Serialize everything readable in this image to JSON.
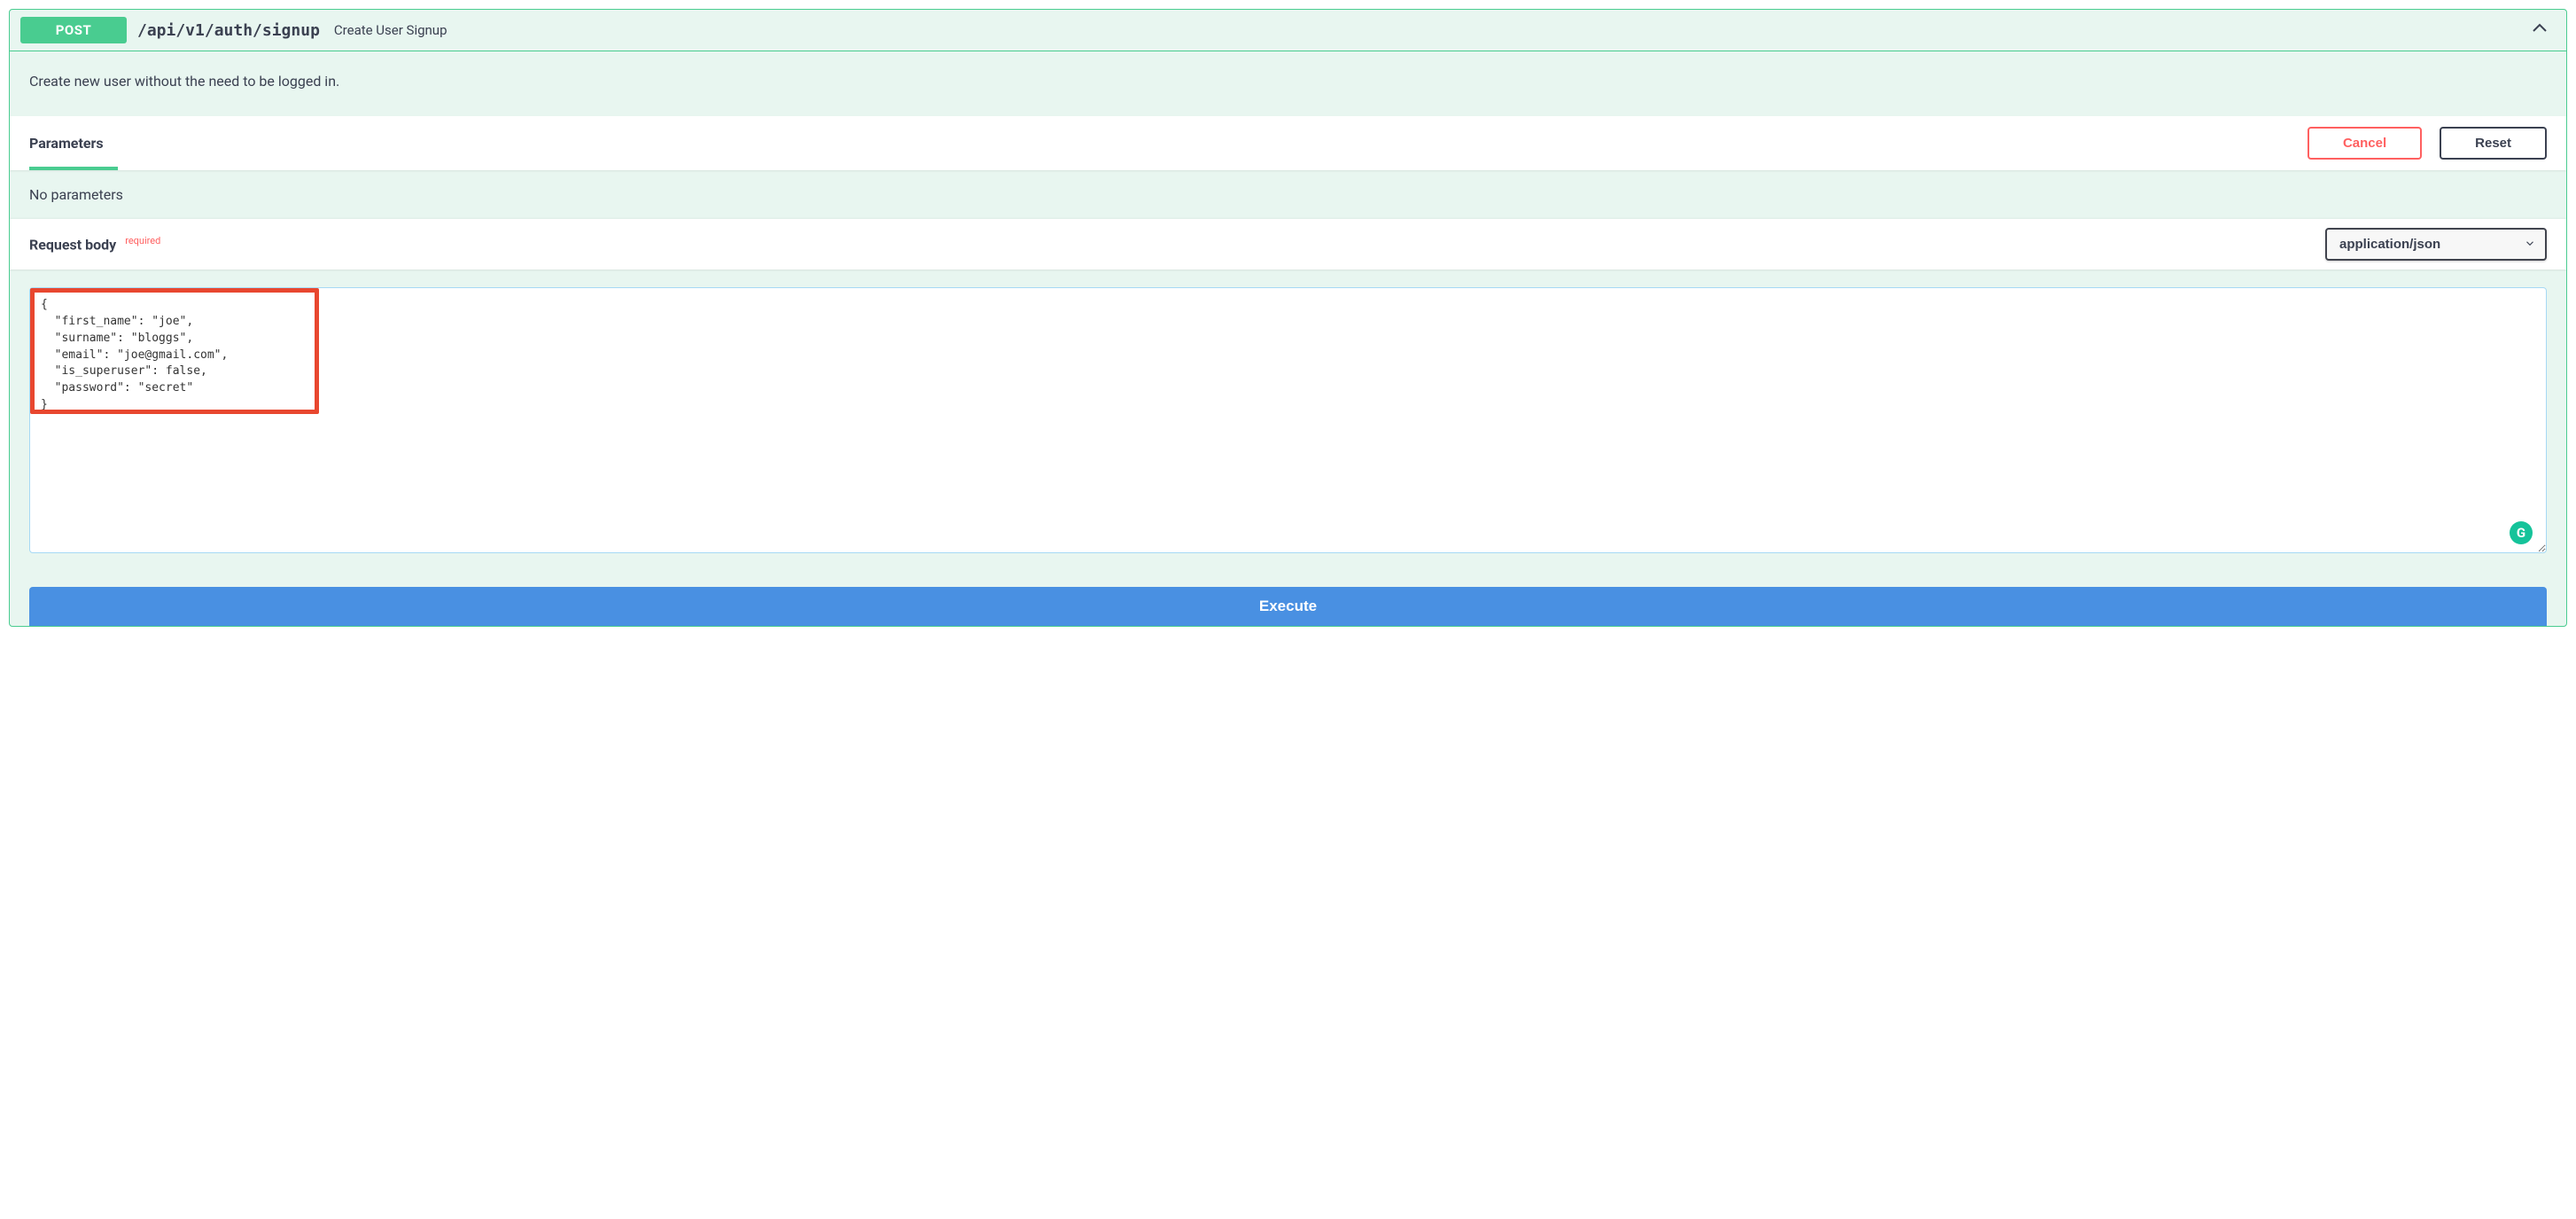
{
  "method": "POST",
  "path": "/api/v1/auth/signup",
  "summary": "Create User Signup",
  "description": "Create new user without the need to be logged in.",
  "parameters": {
    "title": "Parameters",
    "empty_text": "No parameters",
    "cancel_label": "Cancel",
    "reset_label": "Reset"
  },
  "request_body": {
    "title": "Request body",
    "required_label": "required",
    "content_type": "application/json",
    "body_text": "{\n  \"first_name\": \"joe\",\n  \"surname\": \"bloggs\",\n  \"email\": \"joe@gmail.com\",\n  \"is_superuser\": false,\n  \"password\": \"secret\"\n}"
  },
  "execute_label": "Execute",
  "grammarly_letter": "G"
}
